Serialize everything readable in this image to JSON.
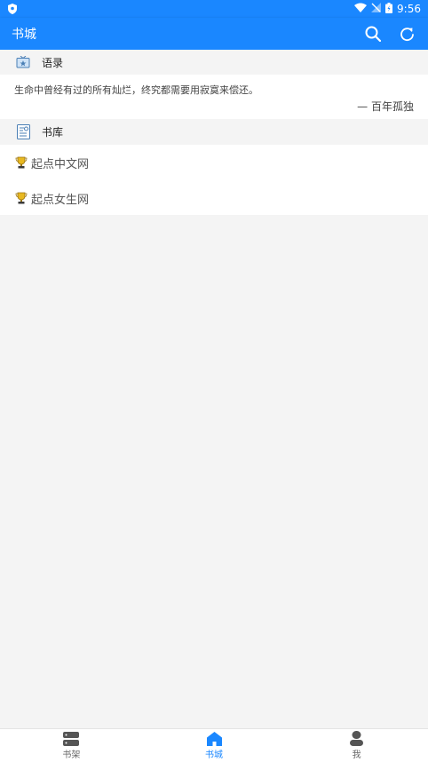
{
  "status_bar": {
    "time": "9:56"
  },
  "app_bar": {
    "title": "书城"
  },
  "quote_section": {
    "title": "语录",
    "text": "生命中曾经有过的所有灿烂，终究都需要用寂寞来偿还。",
    "author": "— 百年孤独"
  },
  "library_section": {
    "title": "书库",
    "items": [
      {
        "label": "起点中文网",
        "icon": "trophy-icon"
      },
      {
        "label": "起点女生网",
        "icon": "trophy-icon"
      }
    ]
  },
  "bottom_nav": {
    "items": [
      {
        "label": "书架",
        "icon": "bookshelf-icon",
        "active": false
      },
      {
        "label": "书城",
        "icon": "home-icon",
        "active": true
      },
      {
        "label": "我",
        "icon": "user-icon",
        "active": false
      }
    ]
  },
  "colors": {
    "primary": "#1a87ff",
    "background": "#f4f4f4"
  }
}
